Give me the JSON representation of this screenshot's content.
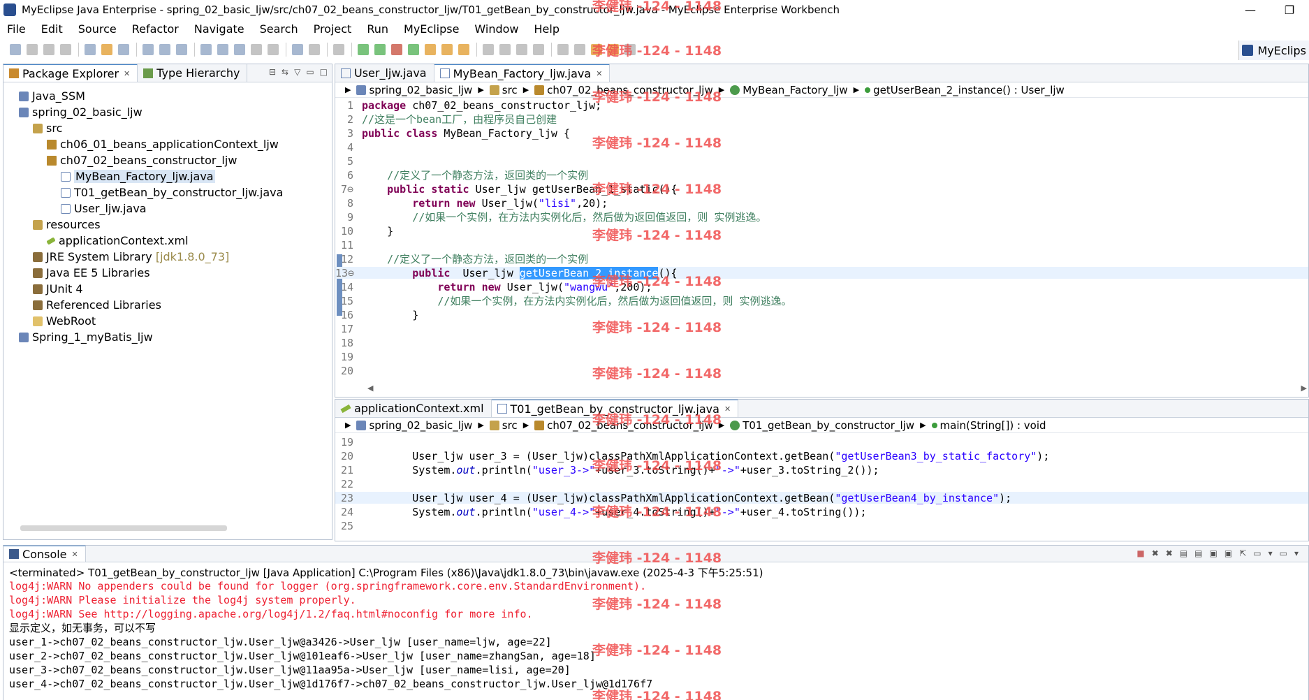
{
  "window": {
    "title": "MyEclipse Java Enterprise - spring_02_basic_ljw/src/ch07_02_beans_constructor_ljw/T01_getBean_by_constructor_ljw.java - MyEclipse Enterprise Workbench",
    "minimize": "—",
    "restore": "❐"
  },
  "menu": [
    "File",
    "Edit",
    "Source",
    "Refactor",
    "Navigate",
    "Search",
    "Project",
    "Run",
    "MyEclipse",
    "Window",
    "Help"
  ],
  "perspective": {
    "label": "MyEclips"
  },
  "explorer": {
    "tabs": [
      "Package Explorer",
      "Type Hierarchy"
    ],
    "nodes": [
      {
        "label": "Java_SSM",
        "icon": "project-icon"
      },
      {
        "label": "spring_02_basic_ljw",
        "icon": "project-icon"
      },
      {
        "label": "src",
        "icon": "source-folder-icon"
      },
      {
        "label": "ch06_01_beans_applicationContext_ljw",
        "icon": "package-icon"
      },
      {
        "label": "ch07_02_beans_constructor_ljw",
        "icon": "package-icon"
      },
      {
        "label": "MyBean_Factory_ljw.java",
        "icon": "java-file-icon",
        "selected": true
      },
      {
        "label": "T01_getBean_by_constructor_ljw.java",
        "icon": "java-file-icon"
      },
      {
        "label": "User_ljw.java",
        "icon": "java-file-icon"
      },
      {
        "label": "resources",
        "icon": "source-folder-icon"
      },
      {
        "label": "applicationContext.xml",
        "icon": "xml-file-icon"
      },
      {
        "label": "JRE System Library",
        "suffix": "[jdk1.8.0_73]",
        "icon": "library-icon"
      },
      {
        "label": "Java EE 5 Libraries",
        "icon": "library-icon"
      },
      {
        "label": "JUnit 4",
        "icon": "library-icon"
      },
      {
        "label": "Referenced Libraries",
        "icon": "library-icon"
      },
      {
        "label": "WebRoot",
        "icon": "folder-icon"
      },
      {
        "label": "Spring_1_myBatis_ljw",
        "icon": "project-icon"
      }
    ]
  },
  "editor1": {
    "tabs": [
      "User_ljw.java",
      "MyBean_Factory_ljw.java"
    ],
    "breadcrumb": [
      "spring_02_basic_ljw",
      "src",
      "ch07_02_beans_constructor_ljw",
      "MyBean_Factory_ljw",
      "getUserBean_2_instance() : User_ljw"
    ]
  },
  "editor2": {
    "tabs": [
      "applicationContext.xml",
      "T01_getBean_by_constructor_ljw.java"
    ],
    "breadcrumb": [
      "spring_02_basic_ljw",
      "src",
      "ch07_02_beans_constructor_ljw",
      "T01_getBean_by_constructor_ljw",
      "main(String[]) : void"
    ]
  },
  "console": {
    "tab": "Console",
    "header": "<terminated> T01_getBean_by_constructor_ljw [Java Application] C:\\Program Files (x86)\\Java\\jdk1.8.0_73\\bin\\javaw.exe (2025-4-3 下午5:25:51)",
    "lines": [
      {
        "text": "log4j:WARN No appenders could be found for logger (org.springframework.core.env.StandardEnvironment).",
        "err": true
      },
      {
        "text": "log4j:WARN Please initialize the log4j system properly.",
        "err": true
      },
      {
        "text": "log4j:WARN See http://logging.apache.org/log4j/1.2/faq.html#noconfig for more info.",
        "err": true
      },
      {
        "text": "显示定义，如无事务，可以不写",
        "err": false
      },
      {
        "text": "user_1->ch07_02_beans_constructor_ljw.User_ljw@a3426->User_ljw [user_name=ljw, age=22]",
        "err": false
      },
      {
        "text": "user_2->ch07_02_beans_constructor_ljw.User_ljw@101eaf6->User_ljw [user_name=zhangSan, age=18]",
        "err": false
      },
      {
        "text": "user_3->ch07_02_beans_constructor_ljw.User_ljw@11aa95a->User_ljw [user_name=lisi, age=20]",
        "err": false
      },
      {
        "text": "user_4->ch07_02_beans_constructor_ljw.User_ljw@1d176f7->ch07_02_beans_constructor_ljw.User_ljw@1d176f7",
        "err": false
      }
    ]
  },
  "watermark": "李健玮 -124 - 1148"
}
